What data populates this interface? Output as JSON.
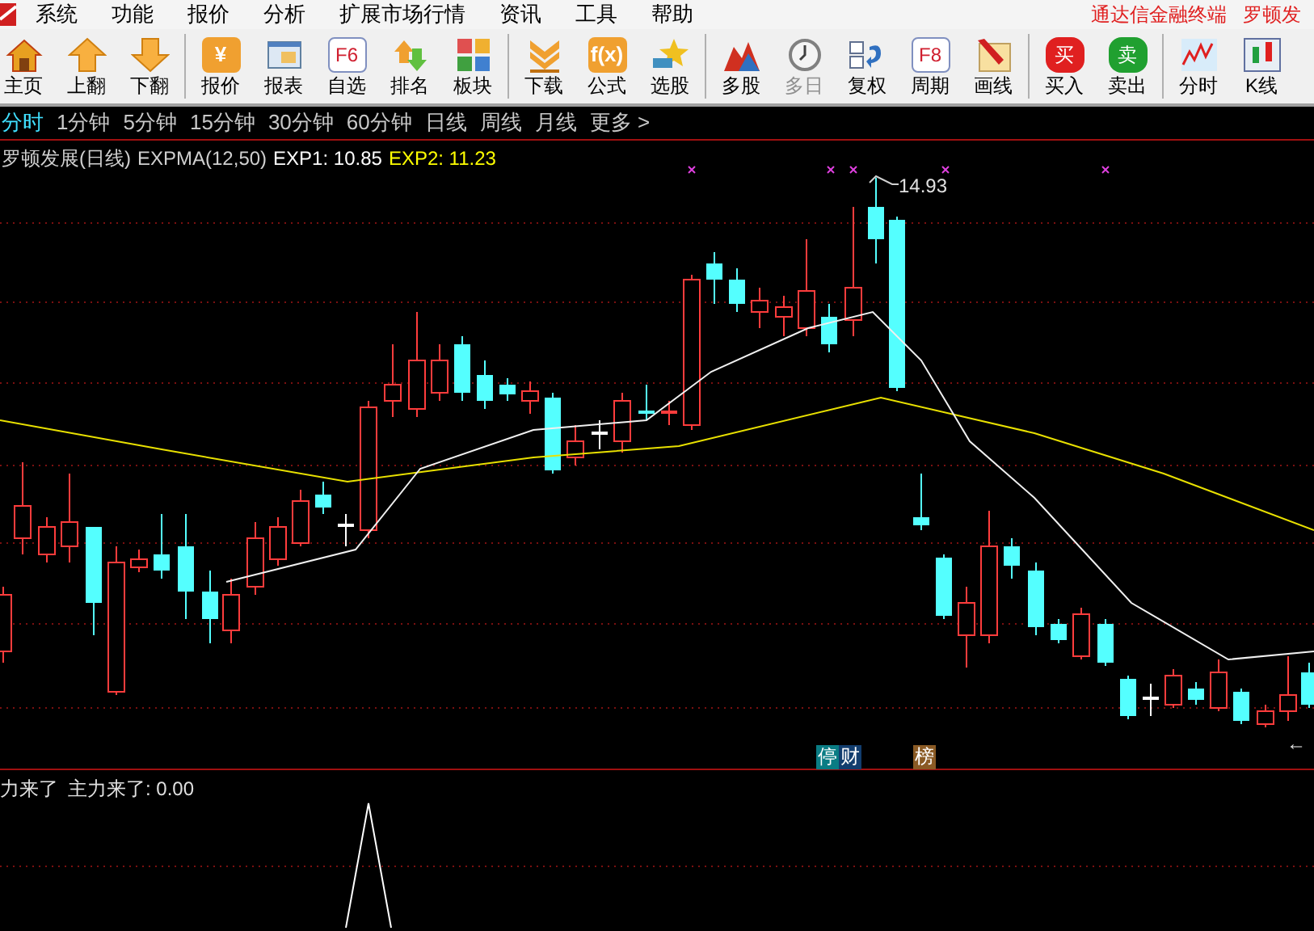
{
  "menu": {
    "items": [
      "系统",
      "功能",
      "报价",
      "分析",
      "扩展市场行情",
      "资讯",
      "工具",
      "帮助"
    ],
    "right_texts": [
      "通达信金融终端",
      "罗顿发"
    ]
  },
  "toolbar": {
    "groups": [
      [
        {
          "label": "主页",
          "disabled": false
        },
        {
          "label": "上翻",
          "disabled": false
        },
        {
          "label": "下翻",
          "disabled": false
        }
      ],
      [
        {
          "label": "报价",
          "glyph": "¥",
          "disabled": false
        },
        {
          "label": "报表",
          "disabled": false
        },
        {
          "label": "自选",
          "glyph": "F6",
          "disabled": false
        },
        {
          "label": "排名",
          "disabled": false
        },
        {
          "label": "板块",
          "disabled": false
        }
      ],
      [
        {
          "label": "下载",
          "disabled": false
        },
        {
          "label": "公式",
          "glyph": "f(x)",
          "disabled": false
        },
        {
          "label": "选股",
          "disabled": false
        }
      ],
      [
        {
          "label": "多股",
          "disabled": false
        },
        {
          "label": "多日",
          "disabled": true
        },
        {
          "label": "复权",
          "disabled": false
        },
        {
          "label": "周期",
          "glyph": "F8",
          "disabled": false
        },
        {
          "label": "画线",
          "disabled": false
        }
      ],
      [
        {
          "label": "买入",
          "glyph": "买",
          "disabled": false
        },
        {
          "label": "卖出",
          "glyph": "卖",
          "disabled": false
        }
      ],
      [
        {
          "label": "分时",
          "disabled": false
        },
        {
          "label": "K线",
          "disabled": false
        }
      ]
    ]
  },
  "periods": [
    {
      "label": "分时",
      "selected": true
    },
    {
      "label": "1分钟",
      "selected": false
    },
    {
      "label": "5分钟",
      "selected": false
    },
    {
      "label": "15分钟",
      "selected": false
    },
    {
      "label": "30分钟",
      "selected": false
    },
    {
      "label": "60分钟",
      "selected": false
    },
    {
      "label": "日线",
      "selected": false
    },
    {
      "label": "周线",
      "selected": false
    },
    {
      "label": "月线",
      "selected": false
    },
    {
      "label": "更多 >",
      "selected": false
    }
  ],
  "chart": {
    "legend": [
      {
        "text": "罗顿发展(日线)",
        "color": "#d0d0d0"
      },
      {
        "text": "EXPMA(12,50)",
        "color": "#d0d0d0"
      },
      {
        "text": "EXP1: 10.85",
        "color": "#ffffff"
      },
      {
        "text": "EXP2: 11.23",
        "color": "#ffff00"
      }
    ],
    "high_label": "14.93",
    "low_label": "←",
    "tags": [
      {
        "text": "停",
        "color": "#0a7c84"
      },
      {
        "text": "财",
        "color": "#123d6e"
      },
      {
        "text": "榜",
        "color": "#8a5a24"
      }
    ]
  },
  "indicator": {
    "name": "力来了",
    "value": "主力来了: 0.00"
  }
}
